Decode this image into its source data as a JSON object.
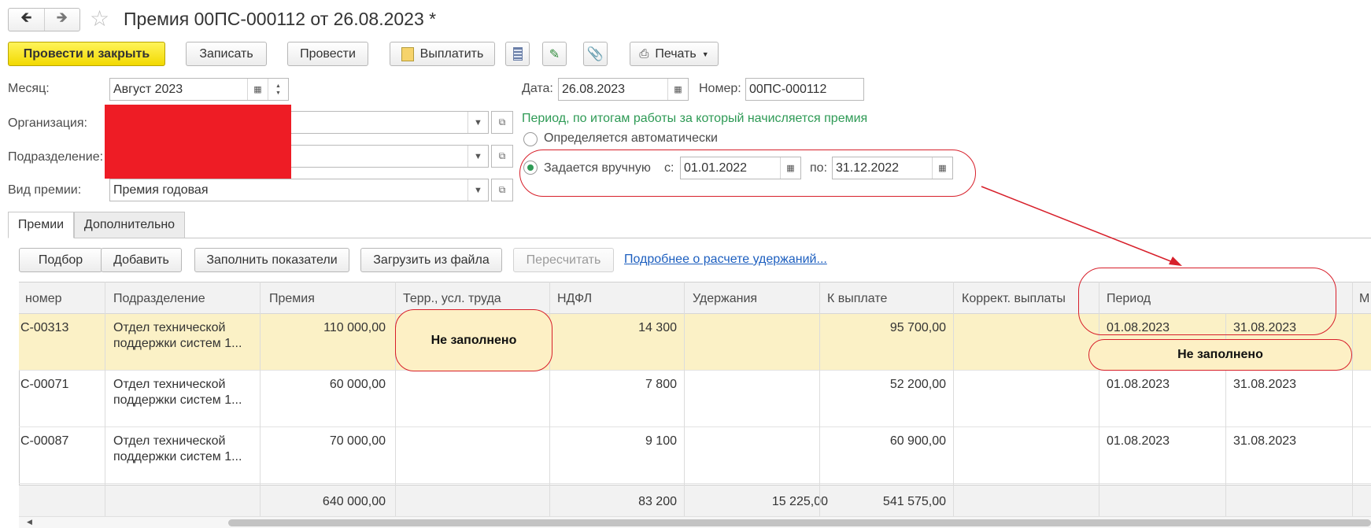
{
  "title": "Премия 00ПС-000112 от 26.08.2023 *",
  "toolbar": {
    "post_close": "Провести и закрыть",
    "write": "Записать",
    "post": "Провести",
    "pay": "Выплатить",
    "print": "Печать"
  },
  "form": {
    "month_label": "Месяц:",
    "month_value": "Август 2023",
    "org_label": "Организация:",
    "dept_label": "Подразделение:",
    "bonus_type_label": "Вид премии:",
    "bonus_type_value": "Премия годовая",
    "date_label": "Дата:",
    "date_value": "26.08.2023",
    "number_label": "Номер:",
    "number_value": "00ПС-000112",
    "period_caption": "Период, по итогам работы за который начисляется премия",
    "radio_auto": "Определяется автоматически",
    "radio_manual": "Задается вручную",
    "from_label": "с:",
    "from_value": "01.01.2022",
    "to_label": "по:",
    "to_value": "31.12.2022"
  },
  "tabs": [
    "Премии",
    "Дополнительно"
  ],
  "table_toolbar": {
    "pick": "Подбор",
    "add": "Добавить",
    "fill": "Заполнить показатели",
    "load": "Загрузить из файла",
    "recalc": "Пересчитать",
    "details_link": "Подробнее о расчете удержаний..."
  },
  "columns": [
    "номер",
    "Подразделение",
    "Премия",
    "Терр., усл. труда",
    "НДФЛ",
    "Удержания",
    "К выплате",
    "Коррект. выплаты",
    "Период",
    "М"
  ],
  "rows": [
    {
      "num": "С-00313",
      "dept1": "Отдел технической",
      "dept2": "поддержки систем 1...",
      "bonus": "110 000,00",
      "ndfl": "14 300",
      "deductions": "",
      "payout": "95 700,00",
      "from": "01.08.2023",
      "to": "31.08.2023"
    },
    {
      "num": "С-00071",
      "dept1": "Отдел технической",
      "dept2": "поддержки систем 1...",
      "bonus": "60 000,00",
      "ndfl": "7 800",
      "deductions": "",
      "payout": "52 200,00",
      "from": "01.08.2023",
      "to": "31.08.2023"
    },
    {
      "num": "С-00087",
      "dept1": "Отдел технической",
      "dept2": "поддержки систем 1...",
      "bonus": "70 000,00",
      "ndfl": "9 100",
      "deductions": "",
      "payout": "60 900,00",
      "from": "01.08.2023",
      "to": "31.08.2023"
    }
  ],
  "totals": {
    "bonus": "640 000,00",
    "ndfl": "83 200",
    "deductions": "15 225,00",
    "payout": "541 575,00"
  },
  "annotations": {
    "not_filled_1": "Не заполнено",
    "not_filled_2": "Не заполнено"
  },
  "colors": {
    "primary_button": "#f5dc00",
    "annotation": "#d71f2a",
    "period_caption": "#2e9a55",
    "link": "#1d5fbf",
    "redaction": "#ee1c25"
  },
  "icons": [
    "back-arrow-icon",
    "forward-arrow-icon",
    "star-icon",
    "calendar-icon",
    "spin-icon",
    "dropdown-icon",
    "open-link-icon",
    "report-icon",
    "edit-icon",
    "attach-icon",
    "printer-icon"
  ]
}
